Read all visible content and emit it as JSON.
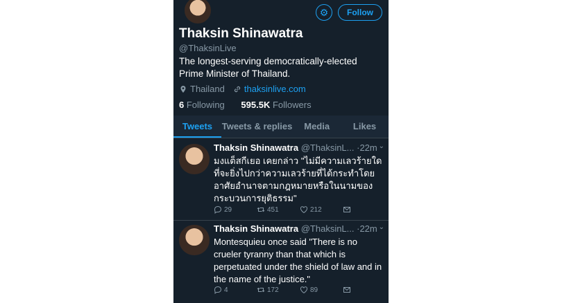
{
  "profile": {
    "name": "Thaksin Shinawatra",
    "handle": "@ThaksinLive",
    "bio": "The longest-serving democratically-elected Prime Minister of Thailand.",
    "location": "Thailand",
    "website": "thaksinlive.com",
    "following_count": "6",
    "following_label": "Following",
    "followers_count": "595.5K",
    "followers_label": "Followers",
    "follow_label": "Follow"
  },
  "tabs": [
    "Tweets",
    "Tweets & replies",
    "Media",
    "Likes"
  ],
  "tweets": [
    {
      "name": "Thaksin Shinawatra",
      "handle": "@ThaksinL...",
      "time": "·22m",
      "text": "มงแต็สกีเยอ เคยกล่าว \"ไม่มีความเลวร้ายใด ที่จะยิ่งไปกว่าความเลวร้ายที่ได้กระทำโดยอาศัยอำนาจตามกฎหมายหรือในนามของกระบวนการยุติธรรม\"",
      "replies": "29",
      "retweets": "451",
      "likes": "212"
    },
    {
      "name": "Thaksin Shinawatra",
      "handle": "@ThaksinL...",
      "time": "·22m",
      "text": "Montesquieu once said \"There is no crueler tyranny than that which is perpetuated under the shield of law and in the name of the justice.\"",
      "replies": "4",
      "retweets": "172",
      "likes": "89"
    }
  ],
  "icons": [
    "gear-icon",
    "location-pin-icon",
    "link-icon",
    "reply-icon",
    "retweet-icon",
    "like-icon",
    "message-icon",
    "chevron-down-icon"
  ],
  "colors": {
    "background": "#15202b",
    "accent": "#1da1f2",
    "muted": "#8899a6"
  }
}
